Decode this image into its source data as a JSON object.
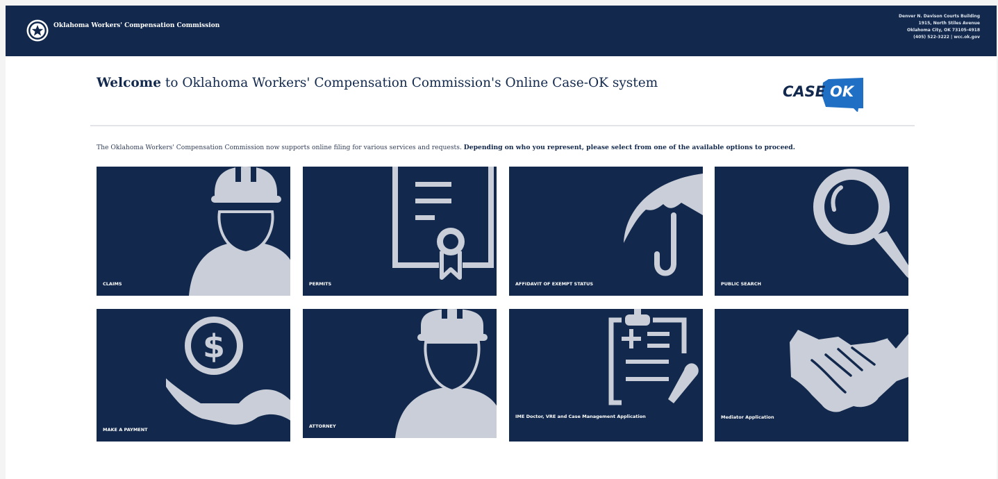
{
  "colors": {
    "navy": "#12294d",
    "icon_gray": "#c9ced8",
    "logo_blue": "#1f6fc5",
    "page_bg": "#ffffff"
  },
  "header": {
    "agency_name": "Oklahoma Workers' Compensation Commission",
    "address": {
      "building": "Denver N. Davison Courts Building",
      "street": "1915, North Stiles Avenue",
      "city": "Oklahoma City, OK 73105-4918",
      "phone_web": "(405) 522-3222 | wcc.ok.gov"
    }
  },
  "welcome": {
    "bold": "Welcome",
    "rest": " to Oklahoma Workers' Compensation Commission's Online Case-OK system"
  },
  "logo": {
    "word1": "CASE",
    "word2": "OK"
  },
  "intro": {
    "text": "The Oklahoma Workers' Compensation Commission now supports online filing for various services and requests. ",
    "bold": "Depending on who you represent, please select from one of the available options to proceed."
  },
  "tiles": [
    {
      "label": "CLAIMS",
      "icon": "hard-hat-worker-icon"
    },
    {
      "label": "PERMITS",
      "icon": "certificate-icon"
    },
    {
      "label": "AFFIDAVIT OF EXEMPT STATUS",
      "icon": "umbrella-icon"
    },
    {
      "label": "PUBLIC SEARCH",
      "icon": "magnifying-glass-icon"
    },
    {
      "label": "MAKE A PAYMENT",
      "icon": "hand-coin-icon"
    },
    {
      "label": "ATTORNEY",
      "icon": "hard-hat-worker-icon"
    },
    {
      "label": "IME Doctor, VRE and Case Management Application",
      "icon": "clipboard-pen-icon"
    },
    {
      "label": "Mediator Application",
      "icon": "handshake-icon"
    }
  ]
}
